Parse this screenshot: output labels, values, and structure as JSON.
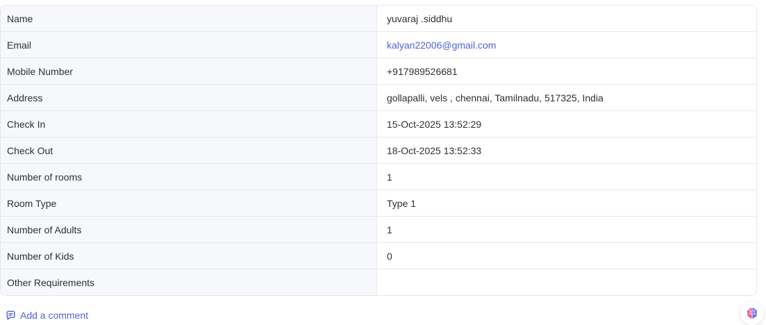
{
  "details": {
    "rows": [
      {
        "label": "Name",
        "value": "yuvaraj .siddhu"
      },
      {
        "label": "Email",
        "value": "kalyan22006@gmail.com"
      },
      {
        "label": "Mobile Number",
        "value": "+917989526681"
      },
      {
        "label": "Address",
        "value": "gollapalli, vels , chennai, Tamilnadu, 517325, India"
      },
      {
        "label": "Check In",
        "value": "15-Oct-2025 13:52:29"
      },
      {
        "label": "Check Out",
        "value": "18-Oct-2025 13:52:33"
      },
      {
        "label": "Number of rooms",
        "value": "1"
      },
      {
        "label": "Room Type",
        "value": "Type 1"
      },
      {
        "label": "Number of Adults",
        "value": "1"
      },
      {
        "label": "Number of Kids",
        "value": "0"
      },
      {
        "label": "Other Requirements",
        "value": ""
      }
    ]
  },
  "actions": {
    "add_comment_label": "Add a comment"
  },
  "icons": {
    "comment": "comment-icon",
    "assistant": "ai-assistant-icon"
  },
  "colors": {
    "link": "#5063d6",
    "label_background": "#f7f8fb",
    "border": "#e6e7eb",
    "text": "#2d2f36"
  }
}
